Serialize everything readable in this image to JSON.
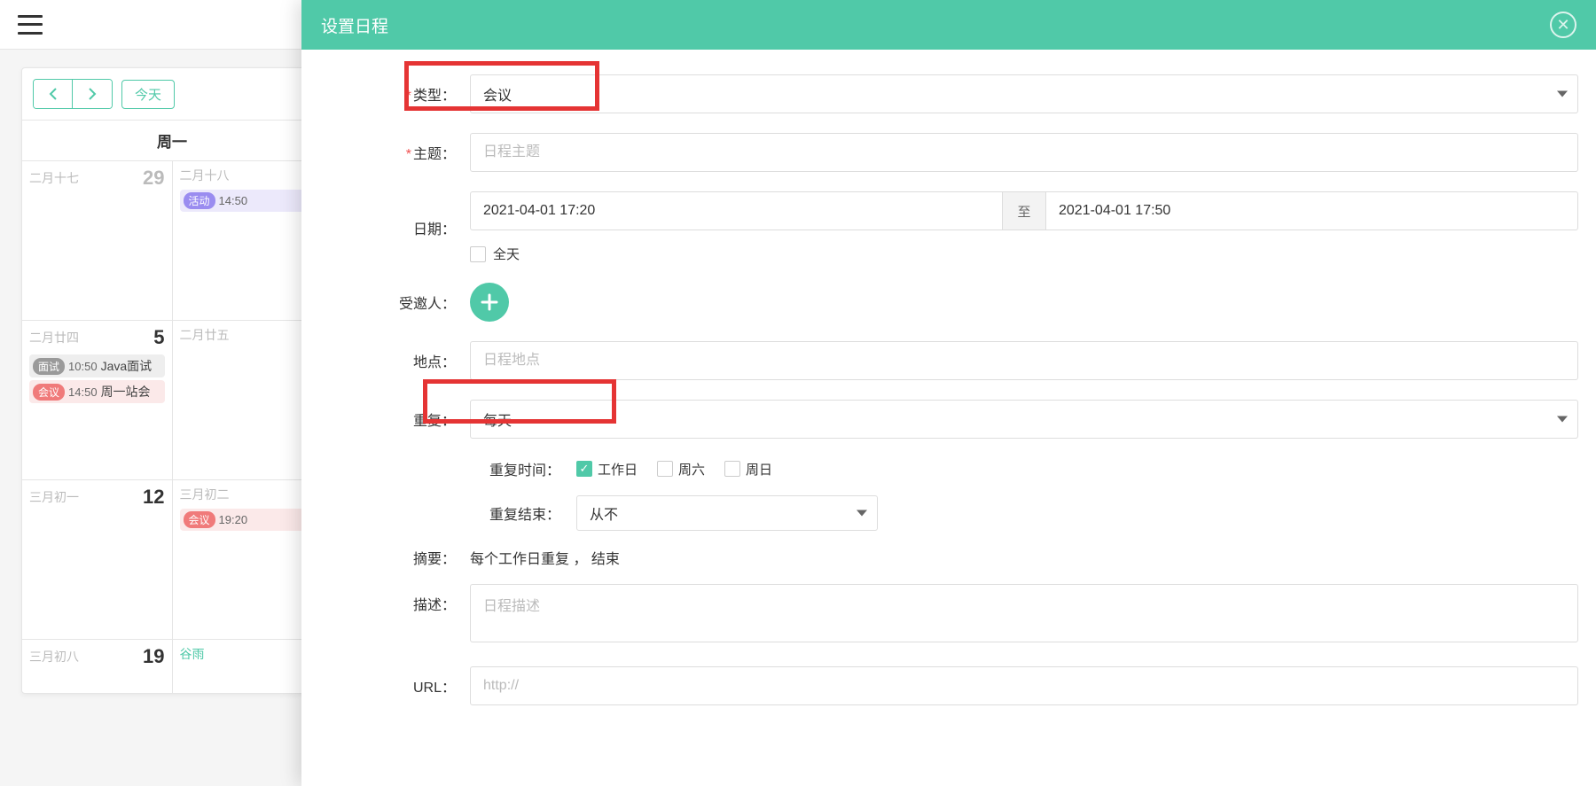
{
  "topbar": {},
  "nav": {
    "today_label": "今天"
  },
  "calendar": {
    "header": "周一",
    "rows": [
      {
        "cells": [
          {
            "lunar": "二月十七",
            "day": "29",
            "day_dark": false,
            "events": []
          },
          {
            "lunar": "二月十八",
            "day": "",
            "day_dark": false,
            "events": [
              {
                "tag_class": "tag-activity",
                "bg": "bg-activity",
                "tag": "活动",
                "time": "14:50",
                "title": ""
              }
            ]
          }
        ]
      },
      {
        "cells": [
          {
            "lunar": "二月廿四",
            "day": "5",
            "day_dark": true,
            "events": [
              {
                "tag_class": "tag-interview",
                "bg": "bg-interview",
                "tag": "面试",
                "time": "10:50",
                "title": "Java面试"
              },
              {
                "tag_class": "tag-meeting",
                "bg": "bg-meeting",
                "tag": "会议",
                "time": "14:50",
                "title": "周一站会"
              }
            ]
          },
          {
            "lunar": "二月廿五",
            "day": "",
            "day_dark": false,
            "events": []
          }
        ]
      },
      {
        "cells": [
          {
            "lunar": "三月初一",
            "day": "12",
            "day_dark": true,
            "events": []
          },
          {
            "lunar": "三月初二",
            "day": "",
            "day_dark": false,
            "events": [
              {
                "tag_class": "tag-meeting",
                "bg": "bg-meeting",
                "tag": "会议",
                "time": "19:20",
                "title": ""
              }
            ]
          }
        ]
      },
      {
        "cells": [
          {
            "lunar": "三月初八",
            "day": "19",
            "day_dark": true,
            "events": []
          },
          {
            "lunar": "",
            "solar_term": "谷雨",
            "day": "",
            "events": []
          }
        ]
      }
    ]
  },
  "modal": {
    "title": "设置日程",
    "form": {
      "type_label": "类型：",
      "type_value": "会议",
      "subject_label": "主题：",
      "subject_placeholder": "日程主题",
      "date_label": "日期：",
      "date_start": "2021-04-01 17:20",
      "date_to": "至",
      "date_end": "2021-04-01 17:50",
      "allday_label": "全天",
      "invitee_label": "受邀人：",
      "location_label": "地点：",
      "location_placeholder": "日程地点",
      "repeat_label": "重复：",
      "repeat_value": "每天",
      "repeat_time_label": "重复时间：",
      "repeat_workday": "工作日",
      "repeat_sat": "周六",
      "repeat_sun": "周日",
      "repeat_end_label": "重复结束：",
      "repeat_end_value": "从不",
      "summary_label": "摘要：",
      "summary_text": "每个工作日重复 ， 结束",
      "desc_label": "描述：",
      "desc_placeholder": "日程描述",
      "url_label": "URL：",
      "url_placeholder": "http://"
    }
  }
}
